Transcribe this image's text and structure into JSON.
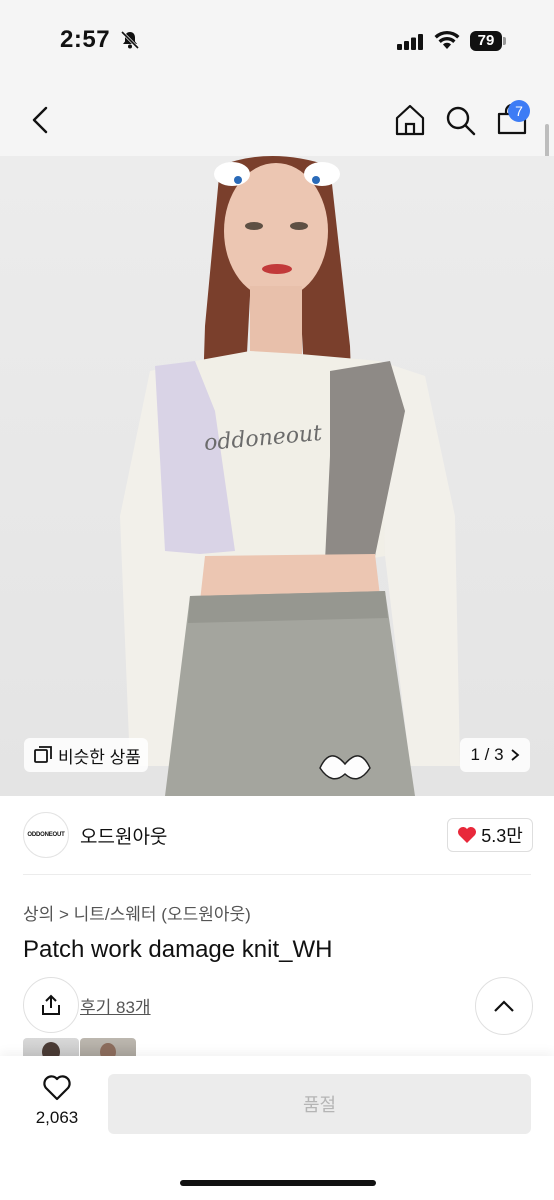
{
  "status_bar": {
    "time": "2:57",
    "battery": "79"
  },
  "header": {
    "cart_count": "7"
  },
  "hero": {
    "similar_label": "비슷한 상품",
    "page_indicator": "1 / 3",
    "logo_text": "oddoneout"
  },
  "brand": {
    "logo_text": "ODDONEOUT",
    "name": "오드원아웃",
    "likes": "5.3만"
  },
  "product": {
    "breadcrumb": "상의 > 니트/스웨터 (오드원아웃)",
    "title": "Patch work damage knit_WH",
    "reviews": "후기 83개"
  },
  "bottom_bar": {
    "wish_count": "2,063",
    "buy_label": "품절"
  },
  "colors": {
    "accent": "#3d7cf5",
    "heart": "#e8283a",
    "soldout_bg": "#ececec"
  }
}
